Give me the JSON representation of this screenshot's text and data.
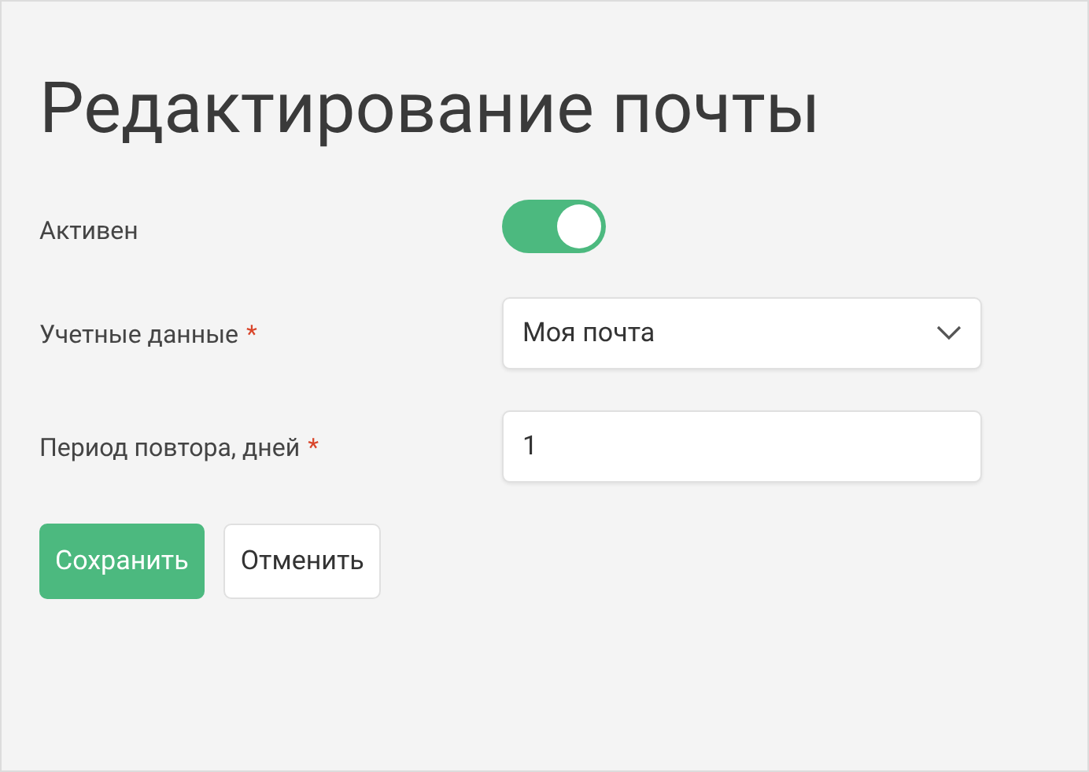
{
  "title": "Редактирование почты",
  "fields": [
    {
      "kind": "toggle",
      "label": "Активен",
      "on": true
    },
    {
      "kind": "select",
      "label": "Учетные данные",
      "required_mark": "*",
      "value": "Моя почта"
    },
    {
      "kind": "text",
      "label": "Период повтора, дней",
      "required_mark": "*",
      "value": "1"
    }
  ],
  "buttons": [
    {
      "kind": "primary",
      "label": "Сохранить"
    },
    {
      "kind": "secondary",
      "label": "Отменить"
    }
  ]
}
